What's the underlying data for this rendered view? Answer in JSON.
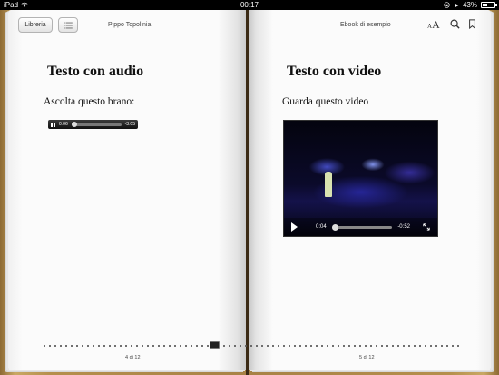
{
  "status": {
    "device": "iPad",
    "time": "00:17",
    "battery_percent": "43%",
    "battery_level": 0.43
  },
  "toolbar": {
    "library_label": "Libreria",
    "left_title": "Pippo Topolinia",
    "right_title": "Ebook di esempio",
    "font_button_label": "AA",
    "icons": [
      "list-icon",
      "font-size-icon",
      "search-icon",
      "bookmark-icon"
    ]
  },
  "left_page": {
    "heading": "Testo con audio",
    "body": "Ascolta questo brano:",
    "audio": {
      "elapsed": "0:06",
      "remaining": "-3:05"
    },
    "page_number": "4 di 12"
  },
  "right_page": {
    "heading": "Testo con video",
    "body": "Guarda questo video",
    "video": {
      "elapsed": "0:04",
      "remaining": "-0:52"
    },
    "page_number": "5 di 12"
  },
  "colors": {
    "cover": "#a88246",
    "page": "#fbfbfb",
    "statusbar": "#000000"
  }
}
